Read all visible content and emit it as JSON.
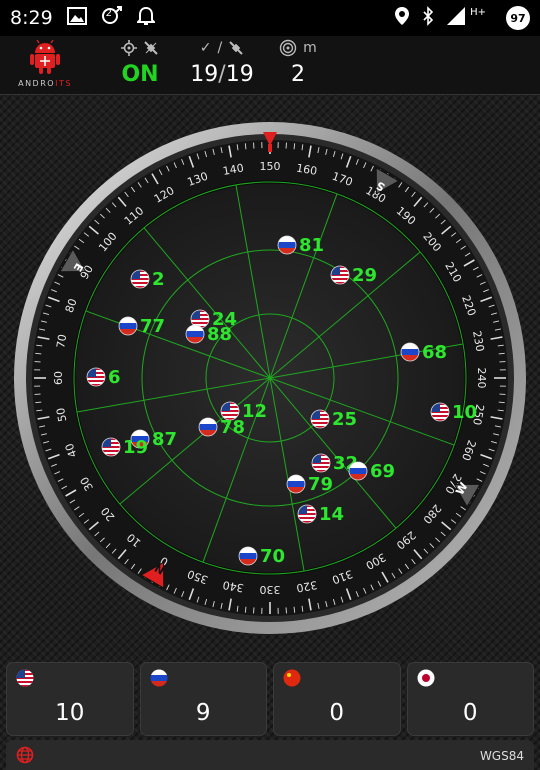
{
  "status_bar": {
    "time": "8:29",
    "notification_badge": "2",
    "network_label": "H+",
    "battery": "97"
  },
  "header": {
    "logo_prefix": "ANDRO",
    "logo_suffix": "ITS",
    "gps_state": "ON",
    "sats_used": "19",
    "sats_separator": "/",
    "sats_visible": "19",
    "accuracy_unit": "m",
    "accuracy": "2",
    "colors": {
      "on": "#21d421",
      "accent": "#e02020"
    }
  },
  "compass": {
    "degree_labels": [
      "150",
      "160",
      "170",
      "180",
      "190",
      "200",
      "210",
      "220",
      "230",
      "240",
      "250",
      "260",
      "270",
      "280",
      "290",
      "300",
      "310",
      "320",
      "330",
      "340",
      "350",
      "0",
      "10",
      "20",
      "30",
      "40",
      "50",
      "60",
      "70",
      "80",
      "90",
      "100",
      "110",
      "120",
      "130",
      "140"
    ],
    "cardinals": {
      "south": "S",
      "west": "W",
      "north": "N",
      "east": "E"
    },
    "satellites": [
      {
        "id": "81",
        "flag": "ru"
      },
      {
        "id": "2",
        "flag": "us"
      },
      {
        "id": "29",
        "flag": "us"
      },
      {
        "id": "24",
        "flag": "us"
      },
      {
        "id": "88",
        "flag": "ru"
      },
      {
        "id": "77",
        "flag": "ru"
      },
      {
        "id": "68",
        "flag": "ru"
      },
      {
        "id": "6",
        "flag": "us"
      },
      {
        "id": "10",
        "flag": "us"
      },
      {
        "id": "12",
        "flag": "us"
      },
      {
        "id": "25",
        "flag": "us"
      },
      {
        "id": "78",
        "flag": "ru"
      },
      {
        "id": "87",
        "flag": "ru"
      },
      {
        "id": "19",
        "flag": "us"
      },
      {
        "id": "32",
        "flag": "us"
      },
      {
        "id": "69",
        "flag": "ru"
      },
      {
        "id": "79",
        "flag": "ru"
      },
      {
        "id": "14",
        "flag": "us"
      },
      {
        "id": "70",
        "flag": "ru"
      }
    ]
  },
  "constellation_counts": [
    {
      "flag": "us",
      "count": "10"
    },
    {
      "flag": "ru",
      "count": "9"
    },
    {
      "flag": "cn",
      "count": "0"
    },
    {
      "flag": "jp",
      "count": "0"
    }
  ],
  "footer": {
    "datum": "WGS84"
  }
}
